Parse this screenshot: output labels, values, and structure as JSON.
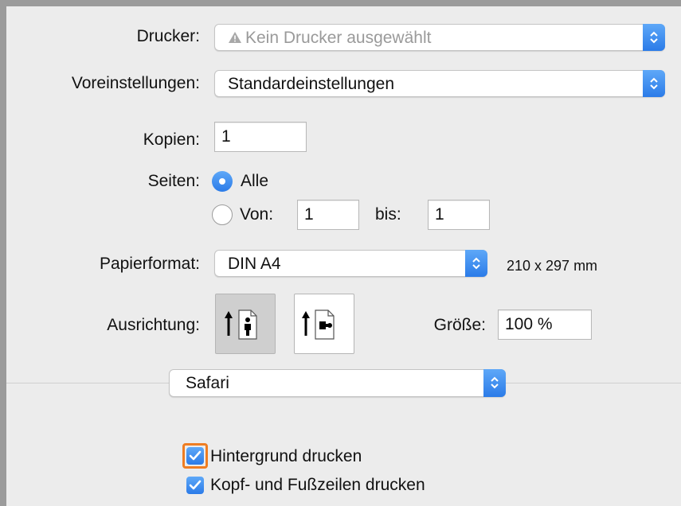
{
  "printer": {
    "label": "Drucker:",
    "value": "Kein Drucker ausgewählt",
    "warning_icon": "warning-triangle-icon"
  },
  "presets": {
    "label": "Voreinstellungen:",
    "value": "Standardeinstellungen"
  },
  "copies": {
    "label": "Kopien:",
    "value": "1"
  },
  "pages": {
    "label": "Seiten:",
    "all_label": "Alle",
    "all_selected": true,
    "from_label": "Von:",
    "from_value": "1",
    "to_label": "bis:",
    "to_value": "1"
  },
  "paper": {
    "label": "Papierformat:",
    "value": "DIN A4",
    "dimensions": "210 x 297 mm"
  },
  "orientation": {
    "label": "Ausrichtung:",
    "options": [
      "portrait",
      "landscape"
    ],
    "selected": "portrait"
  },
  "scale": {
    "label": "Größe:",
    "value": "100 %"
  },
  "section": {
    "value": "Safari"
  },
  "options": [
    {
      "label": "Hintergrund drucken",
      "checked": true,
      "focused": true
    },
    {
      "label": "Kopf- und Fußzeilen drucken",
      "checked": true,
      "focused": false
    }
  ],
  "colors": {
    "accent": "#2b7be8",
    "focus_ring": "#ef7d22"
  }
}
